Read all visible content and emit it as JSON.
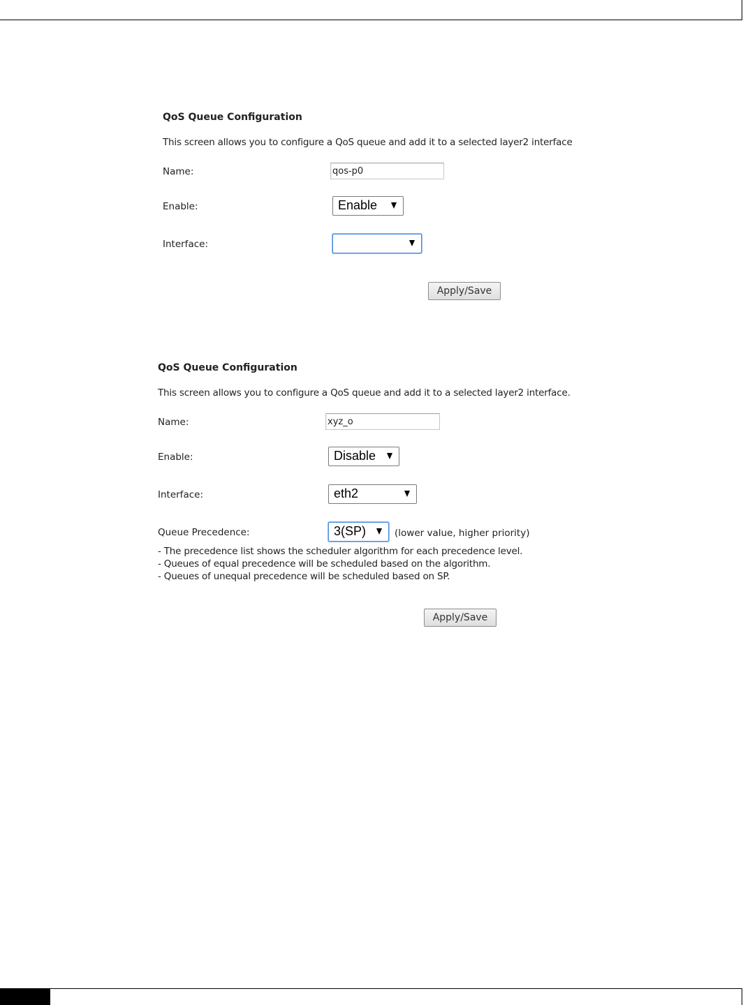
{
  "panel1": {
    "title": "QoS Queue Configuration",
    "description": "This screen allows you to configure a QoS queue and add it to a selected layer2 interface",
    "name_label": "Name:",
    "name_value": "qos-p0",
    "enable_label": "Enable:",
    "enable_value": "Enable",
    "interface_label": "Interface:",
    "interface_value": "",
    "apply_label": "Apply/Save"
  },
  "panel2": {
    "title": "QoS Queue Configuration",
    "description": "This screen allows you to configure a QoS queue and add it to a selected layer2 interface.",
    "name_label": "Name:",
    "name_value": "xyz_o",
    "enable_label": "Enable:",
    "enable_value": "Disable",
    "interface_label": "Interface:",
    "interface_value": "eth2",
    "precedence_label": "Queue Precedence:",
    "precedence_value": "3(SP)",
    "precedence_hint": "(lower value, higher priority)",
    "notes": [
      "- The precedence list shows the scheduler algorithm for each precedence level.",
      "- Queues of equal precedence will be scheduled based on the algorithm.",
      "- Queues of unequal precedence will be scheduled based on SP."
    ],
    "apply_label": "Apply/Save"
  },
  "icons": {
    "dropdown_arrow": "triangle-down-icon"
  }
}
